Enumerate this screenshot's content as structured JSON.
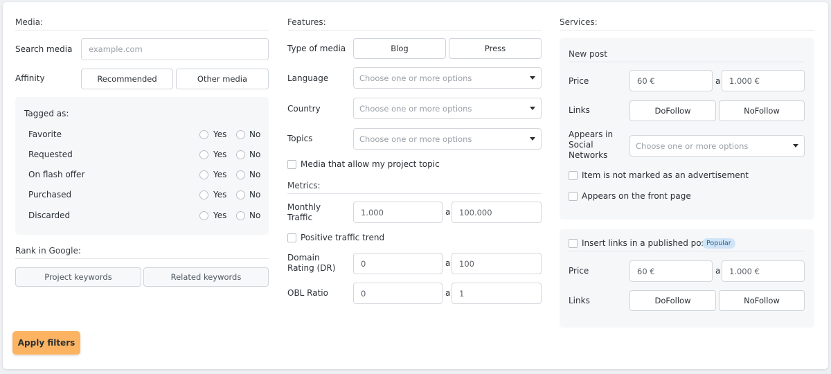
{
  "media": {
    "title": "Media:",
    "search_label": "Search media",
    "search_placeholder": "example.com",
    "affinity_label": "Affinity",
    "affinity_options": [
      "Recommended",
      "Other media"
    ],
    "tagged_title": "Tagged as:",
    "yes": "Yes",
    "no": "No",
    "tags": [
      "Favorite",
      "Requested",
      "On flash offer",
      "Purchased",
      "Discarded"
    ],
    "rank_title": "Rank in Google:",
    "rank_buttons": [
      "Project keywords",
      "Related keywords"
    ]
  },
  "features": {
    "title": "Features:",
    "type_label": "Type of media",
    "type_options": [
      "Blog",
      "Press"
    ],
    "language_label": "Language",
    "country_label": "Country",
    "topics_label": "Topics",
    "select_placeholder": "Choose one or more options",
    "allow_topic": "Media that allow my project topic",
    "metrics_title": "Metrics:",
    "traffic_label": "Monthly Traffic",
    "traffic_min": "1.000",
    "traffic_max": "100.000",
    "positive_trend": "Positive traffic trend",
    "dr_label": "Domain Rating (DR)",
    "dr_min": "0",
    "dr_max": "100",
    "obl_label": "OBL Ratio",
    "obl_min": "0",
    "obl_max": "1",
    "range_sep": "a"
  },
  "services": {
    "title": "Services:",
    "new_post": {
      "title": "New post",
      "price_label": "Price",
      "price_min": "60 €",
      "price_max": "1.000 €",
      "links_label": "Links",
      "links_options": [
        "DoFollow",
        "NoFollow"
      ],
      "social_label": "Appears in Social Networks",
      "social_placeholder": "Choose one or more options",
      "not_ad": "Item is not marked as an advertisement",
      "front_page": "Appears on the front page"
    },
    "insert": {
      "title": "Insert links in a published post",
      "badge": "Popular",
      "price_label": "Price",
      "price_min": "60 €",
      "price_max": "1.000 €",
      "links_label": "Links",
      "links_options": [
        "DoFollow",
        "NoFollow"
      ]
    }
  },
  "apply_label": "Apply filters"
}
